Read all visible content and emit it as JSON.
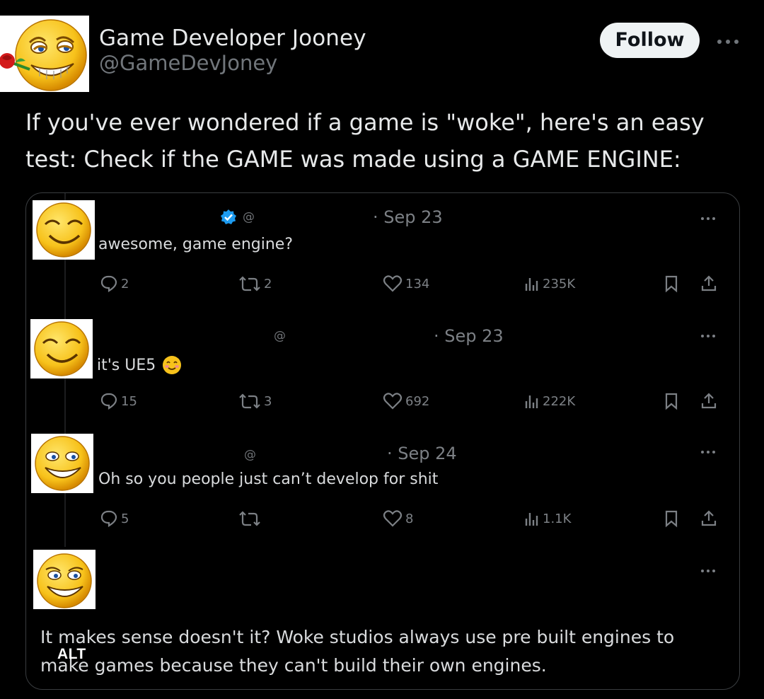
{
  "post": {
    "author_name": "Game Developer Jooney",
    "author_handle": "@GameDevJoney",
    "follow_label": "Follow",
    "text_line1": "If you've ever wondered if a game is \"woke\", here's an easy",
    "text_line2": "test: Check if the GAME was made using a GAME ENGINE:"
  },
  "embed": {
    "alt_label": "ALT",
    "replies": [
      {
        "at": "@",
        "date": "· Sep 23",
        "text": "awesome, game engine?",
        "replies": "2",
        "reposts": "2",
        "likes": "134",
        "views": "235K",
        "verified": true
      },
      {
        "at": "@",
        "date": "· Sep 23",
        "text": "it's UE5",
        "replies": "15",
        "reposts": "3",
        "likes": "692",
        "views": "222K",
        "verified": false
      },
      {
        "at": "@",
        "date": "· Sep 24",
        "text": "Oh so you people just can’t develop for shit",
        "replies": "5",
        "reposts": "",
        "likes": "8",
        "views": "1.1K",
        "verified": false
      }
    ],
    "final_text_line1": "It makes sense doesn't it? Woke studios always use pre built engines to",
    "final_text_line2": "make games because they can't build their own engines."
  },
  "colors": {
    "background": "#000000",
    "text_primary": "#e7e9ea",
    "text_secondary": "#71767b",
    "follow_bg": "#eff3f4",
    "verified_blue": "#1d9bf0",
    "emoji_yellow": "#f7c21b"
  },
  "icons": [
    "rose-icon",
    "reply-icon",
    "repost-icon",
    "like-icon",
    "views-icon",
    "bookmark-icon",
    "share-icon",
    "more-icon",
    "verified-icon",
    "smiling-emoji-icon"
  ]
}
